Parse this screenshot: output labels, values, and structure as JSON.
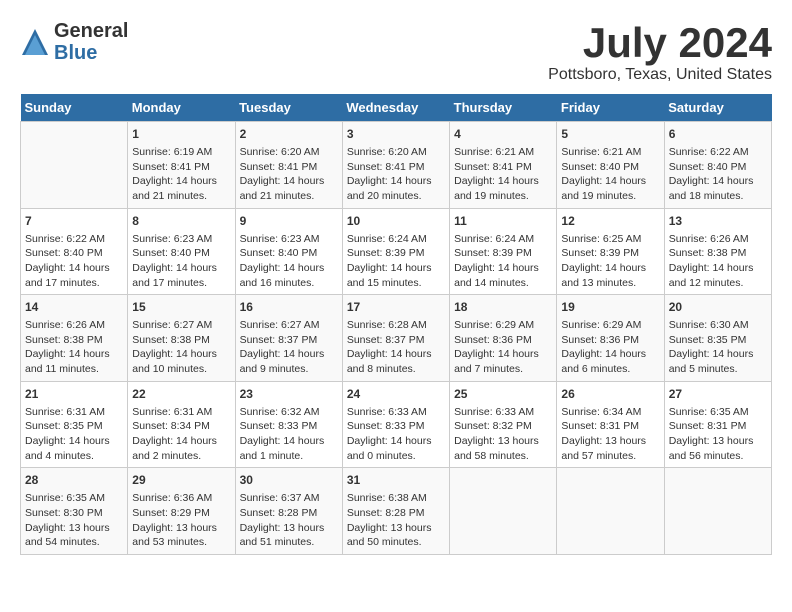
{
  "header": {
    "logo_general": "General",
    "logo_blue": "Blue",
    "title": "July 2024",
    "location": "Pottsboro, Texas, United States"
  },
  "calendar": {
    "days_of_week": [
      "Sunday",
      "Monday",
      "Tuesday",
      "Wednesday",
      "Thursday",
      "Friday",
      "Saturday"
    ],
    "weeks": [
      [
        {
          "day": "",
          "content": ""
        },
        {
          "day": "1",
          "content": "Sunrise: 6:19 AM\nSunset: 8:41 PM\nDaylight: 14 hours\nand 21 minutes."
        },
        {
          "day": "2",
          "content": "Sunrise: 6:20 AM\nSunset: 8:41 PM\nDaylight: 14 hours\nand 21 minutes."
        },
        {
          "day": "3",
          "content": "Sunrise: 6:20 AM\nSunset: 8:41 PM\nDaylight: 14 hours\nand 20 minutes."
        },
        {
          "day": "4",
          "content": "Sunrise: 6:21 AM\nSunset: 8:41 PM\nDaylight: 14 hours\nand 19 minutes."
        },
        {
          "day": "5",
          "content": "Sunrise: 6:21 AM\nSunset: 8:40 PM\nDaylight: 14 hours\nand 19 minutes."
        },
        {
          "day": "6",
          "content": "Sunrise: 6:22 AM\nSunset: 8:40 PM\nDaylight: 14 hours\nand 18 minutes."
        }
      ],
      [
        {
          "day": "7",
          "content": "Sunrise: 6:22 AM\nSunset: 8:40 PM\nDaylight: 14 hours\nand 17 minutes."
        },
        {
          "day": "8",
          "content": "Sunrise: 6:23 AM\nSunset: 8:40 PM\nDaylight: 14 hours\nand 17 minutes."
        },
        {
          "day": "9",
          "content": "Sunrise: 6:23 AM\nSunset: 8:40 PM\nDaylight: 14 hours\nand 16 minutes."
        },
        {
          "day": "10",
          "content": "Sunrise: 6:24 AM\nSunset: 8:39 PM\nDaylight: 14 hours\nand 15 minutes."
        },
        {
          "day": "11",
          "content": "Sunrise: 6:24 AM\nSunset: 8:39 PM\nDaylight: 14 hours\nand 14 minutes."
        },
        {
          "day": "12",
          "content": "Sunrise: 6:25 AM\nSunset: 8:39 PM\nDaylight: 14 hours\nand 13 minutes."
        },
        {
          "day": "13",
          "content": "Sunrise: 6:26 AM\nSunset: 8:38 PM\nDaylight: 14 hours\nand 12 minutes."
        }
      ],
      [
        {
          "day": "14",
          "content": "Sunrise: 6:26 AM\nSunset: 8:38 PM\nDaylight: 14 hours\nand 11 minutes."
        },
        {
          "day": "15",
          "content": "Sunrise: 6:27 AM\nSunset: 8:38 PM\nDaylight: 14 hours\nand 10 minutes."
        },
        {
          "day": "16",
          "content": "Sunrise: 6:27 AM\nSunset: 8:37 PM\nDaylight: 14 hours\nand 9 minutes."
        },
        {
          "day": "17",
          "content": "Sunrise: 6:28 AM\nSunset: 8:37 PM\nDaylight: 14 hours\nand 8 minutes."
        },
        {
          "day": "18",
          "content": "Sunrise: 6:29 AM\nSunset: 8:36 PM\nDaylight: 14 hours\nand 7 minutes."
        },
        {
          "day": "19",
          "content": "Sunrise: 6:29 AM\nSunset: 8:36 PM\nDaylight: 14 hours\nand 6 minutes."
        },
        {
          "day": "20",
          "content": "Sunrise: 6:30 AM\nSunset: 8:35 PM\nDaylight: 14 hours\nand 5 minutes."
        }
      ],
      [
        {
          "day": "21",
          "content": "Sunrise: 6:31 AM\nSunset: 8:35 PM\nDaylight: 14 hours\nand 4 minutes."
        },
        {
          "day": "22",
          "content": "Sunrise: 6:31 AM\nSunset: 8:34 PM\nDaylight: 14 hours\nand 2 minutes."
        },
        {
          "day": "23",
          "content": "Sunrise: 6:32 AM\nSunset: 8:33 PM\nDaylight: 14 hours\nand 1 minute."
        },
        {
          "day": "24",
          "content": "Sunrise: 6:33 AM\nSunset: 8:33 PM\nDaylight: 14 hours\nand 0 minutes."
        },
        {
          "day": "25",
          "content": "Sunrise: 6:33 AM\nSunset: 8:32 PM\nDaylight: 13 hours\nand 58 minutes."
        },
        {
          "day": "26",
          "content": "Sunrise: 6:34 AM\nSunset: 8:31 PM\nDaylight: 13 hours\nand 57 minutes."
        },
        {
          "day": "27",
          "content": "Sunrise: 6:35 AM\nSunset: 8:31 PM\nDaylight: 13 hours\nand 56 minutes."
        }
      ],
      [
        {
          "day": "28",
          "content": "Sunrise: 6:35 AM\nSunset: 8:30 PM\nDaylight: 13 hours\nand 54 minutes."
        },
        {
          "day": "29",
          "content": "Sunrise: 6:36 AM\nSunset: 8:29 PM\nDaylight: 13 hours\nand 53 minutes."
        },
        {
          "day": "30",
          "content": "Sunrise: 6:37 AM\nSunset: 8:28 PM\nDaylight: 13 hours\nand 51 minutes."
        },
        {
          "day": "31",
          "content": "Sunrise: 6:38 AM\nSunset: 8:28 PM\nDaylight: 13 hours\nand 50 minutes."
        },
        {
          "day": "",
          "content": ""
        },
        {
          "day": "",
          "content": ""
        },
        {
          "day": "",
          "content": ""
        }
      ]
    ]
  }
}
